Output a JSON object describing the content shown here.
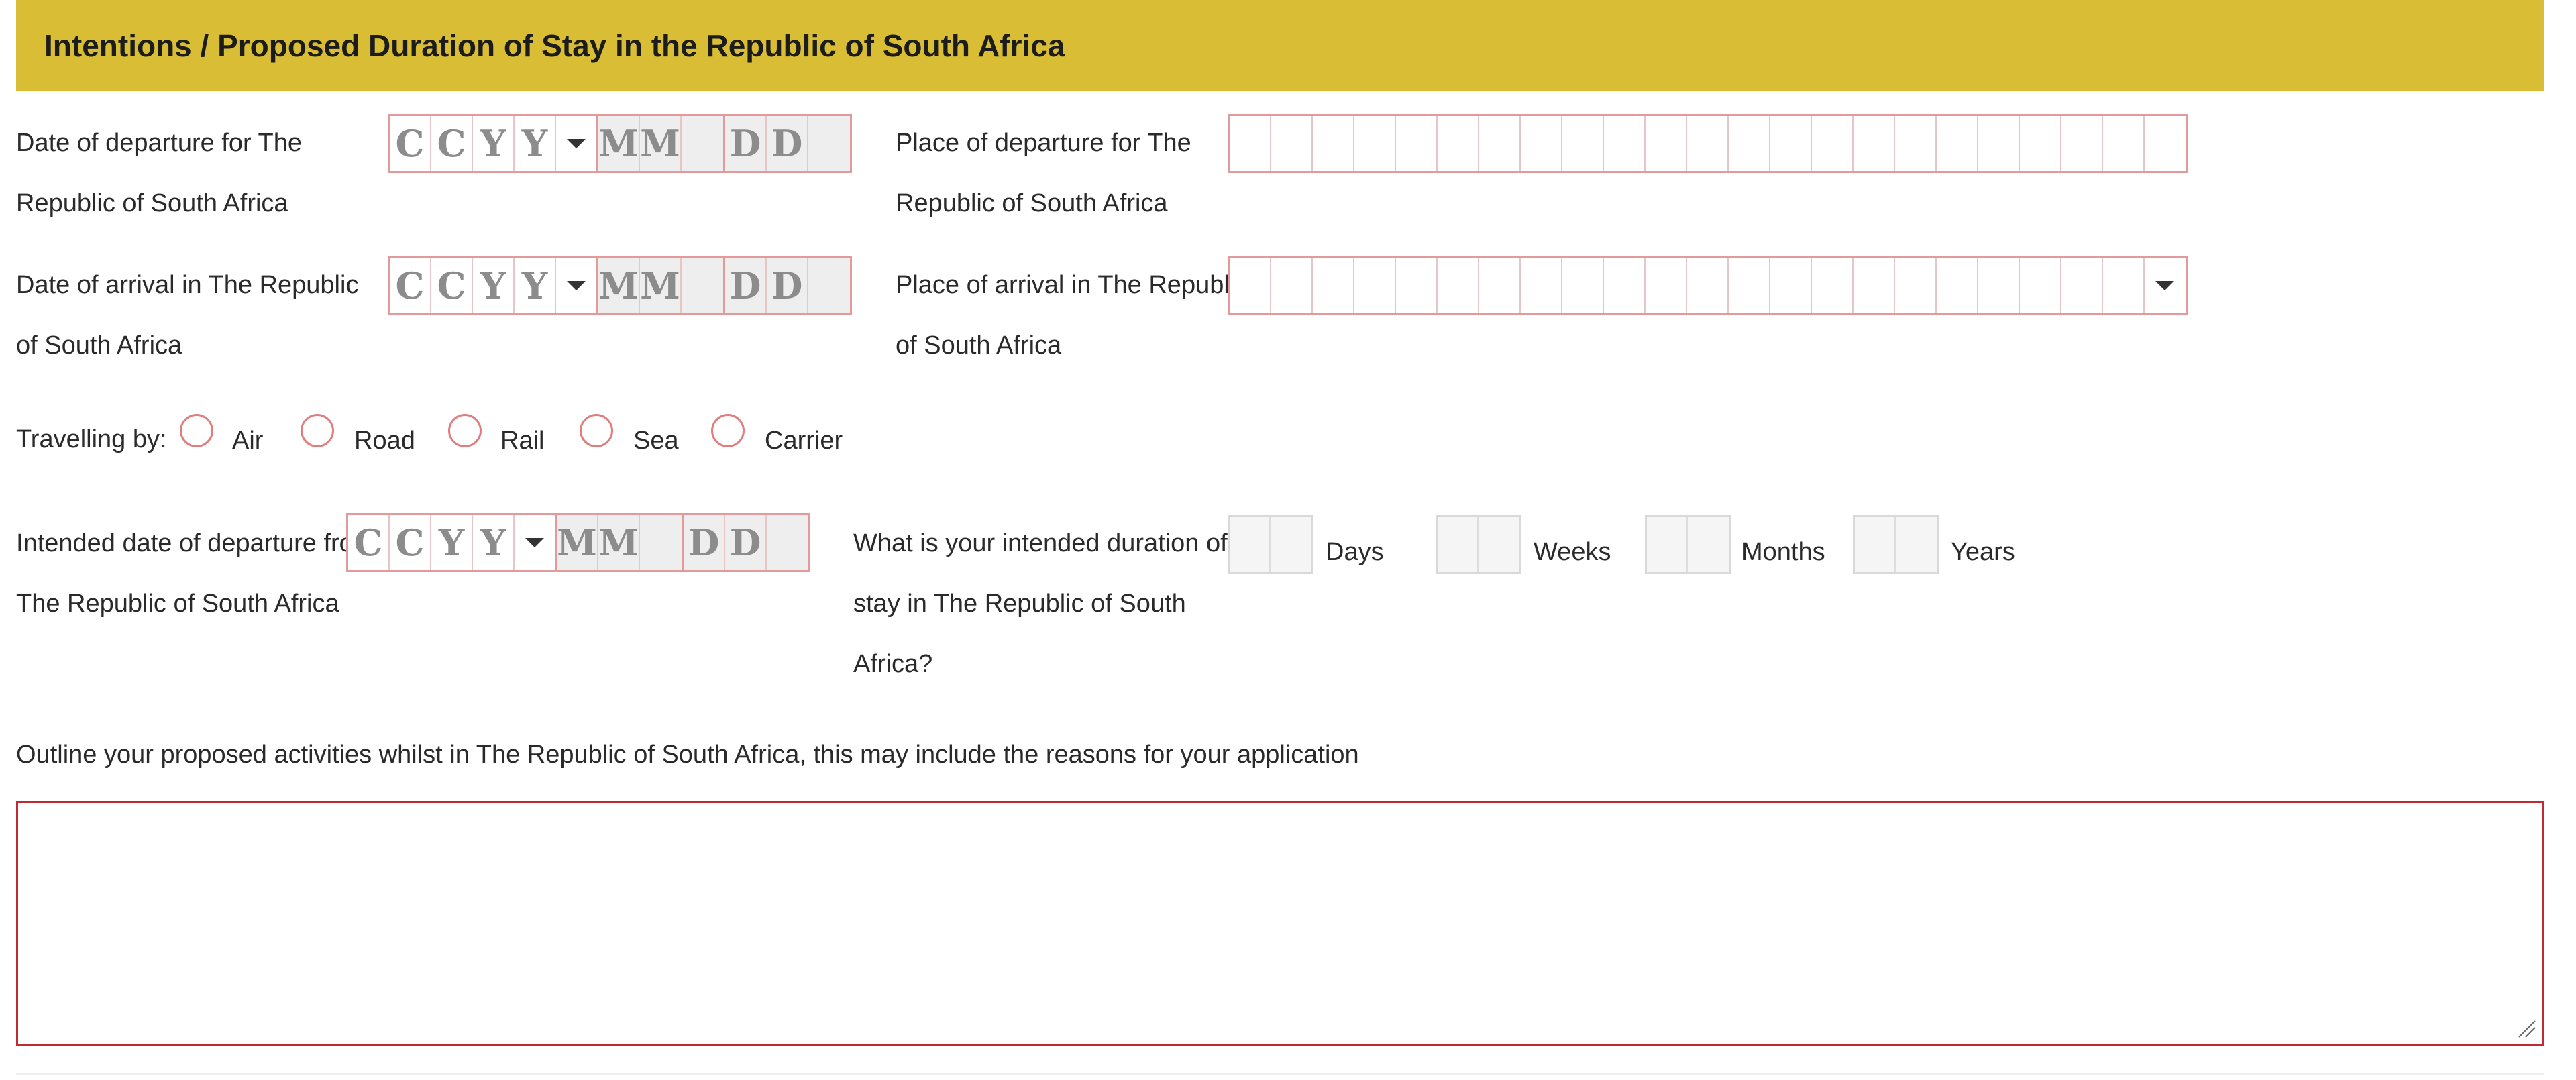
{
  "section": {
    "title": "Intentions / Proposed Duration of Stay in the Republic of South Africa"
  },
  "date_placeholders": {
    "c": "C",
    "y": "Y",
    "m": "M",
    "d": "D"
  },
  "departure_date": {
    "label_line1": "Date of departure for The",
    "label_line2": "Republic of South Africa"
  },
  "departure_place": {
    "label_line1": "Place of departure for The",
    "label_line2": "Republic of South Africa"
  },
  "arrival_date": {
    "label_line1": "Date of arrival in The Republic",
    "label_line2": "of South Africa"
  },
  "arrival_place": {
    "label_line1": "Place of arrival in The Republic",
    "label_line2": "of South Africa"
  },
  "travelling": {
    "label": "Travelling by:",
    "options": [
      "Air",
      "Road",
      "Rail",
      "Sea",
      "Carrier"
    ]
  },
  "intended_departure": {
    "label_line1": "Intended date of departure from",
    "label_line2": "The Republic of South Africa"
  },
  "duration": {
    "label_line1": "What is your intended duration of",
    "label_line2": "stay in The Republic of South",
    "label_line3": "Africa?",
    "units": [
      "Days",
      "Weeks",
      "Months",
      "Years"
    ]
  },
  "activities": {
    "label": "Outline your proposed activities whilst in The Republic of South Africa, this may include the reasons for your application",
    "value": ""
  },
  "colors": {
    "banner": "#d8bd35",
    "field_border": "#e39a9a",
    "textarea_border": "#c22a33"
  },
  "icons": [
    "chevron-down-icon",
    "radio-icon",
    "resize-handle-icon"
  ]
}
